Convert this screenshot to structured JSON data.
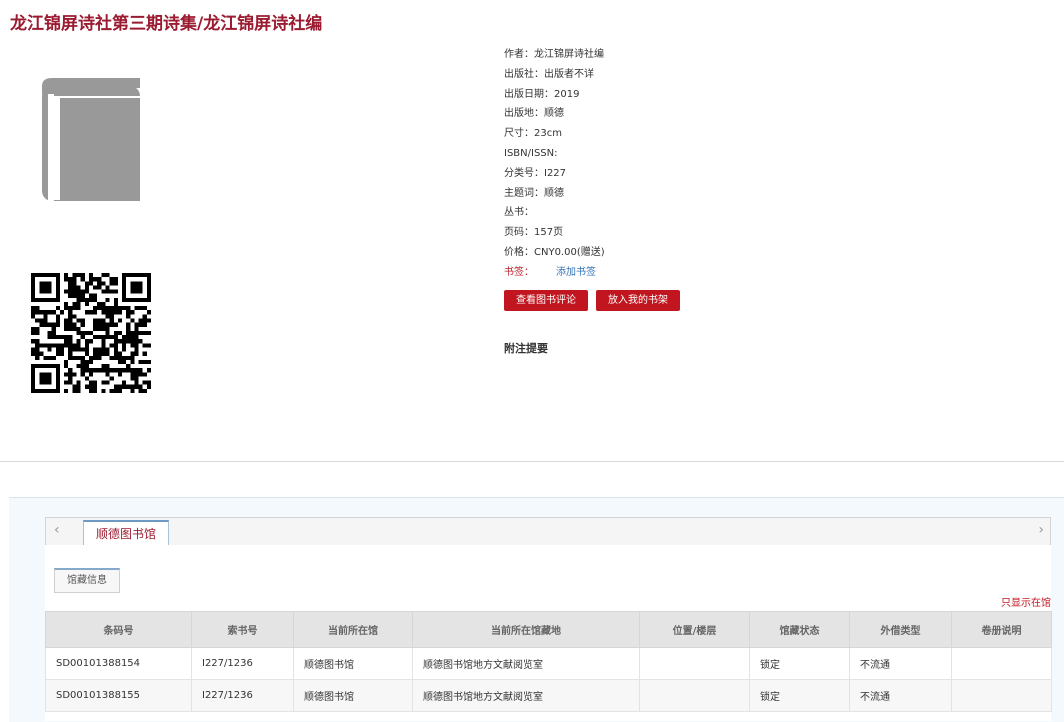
{
  "title": "龙江锦屏诗社第三期诗集/龙江锦屏诗社编",
  "icons": [
    "book-icon",
    "qr-code",
    "chevron-left-icon",
    "chevron-right-icon"
  ],
  "meta": [
    {
      "label": "作者：",
      "value": "龙江锦屏诗社编"
    },
    {
      "label": "出版社：",
      "value": "出版者不详"
    },
    {
      "label": "出版日期：",
      "value": "2019"
    },
    {
      "label": "出版地：",
      "value": "顺德"
    },
    {
      "label": "尺寸：",
      "value": "23cm"
    },
    {
      "label": "ISBN/ISSN:",
      "value": ""
    },
    {
      "label": "分类号：",
      "value": "I227"
    },
    {
      "label": "主题词：",
      "value": "顺德"
    },
    {
      "label": "丛书：",
      "value": ""
    },
    {
      "label": "页码：",
      "value": "157页"
    },
    {
      "label": "价格：",
      "value": "CNY0.00(赠送)"
    }
  ],
  "bookmark": {
    "label": "书签：",
    "link": "添加书签"
  },
  "buttons": {
    "reviews": "查看图书评论",
    "shelf": "放入我的书架"
  },
  "notes_heading": "附注提要",
  "holdings": {
    "library_tab": "顺德图书馆",
    "sub_tab": "馆藏信息",
    "only_show": "只显示在馆",
    "columns": [
      "条码号",
      "索书号",
      "当前所在馆",
      "当前所在馆藏地",
      "位置/楼层",
      "馆藏状态",
      "外借类型",
      "卷册说明"
    ],
    "rows": [
      [
        "SD00101388154",
        "I227/1236",
        "顺德图书馆",
        "顺德图书馆地方文献阅览室",
        "",
        "锁定",
        "不流通",
        ""
      ],
      [
        "SD00101388155",
        "I227/1236",
        "顺德图书馆",
        "顺德图书馆地方文献阅览室",
        "",
        "锁定",
        "不流通",
        ""
      ]
    ]
  },
  "colors": {
    "title": "#9b1b30",
    "button": "#c1161f",
    "link": "#3575b8",
    "icon": "#999999"
  }
}
